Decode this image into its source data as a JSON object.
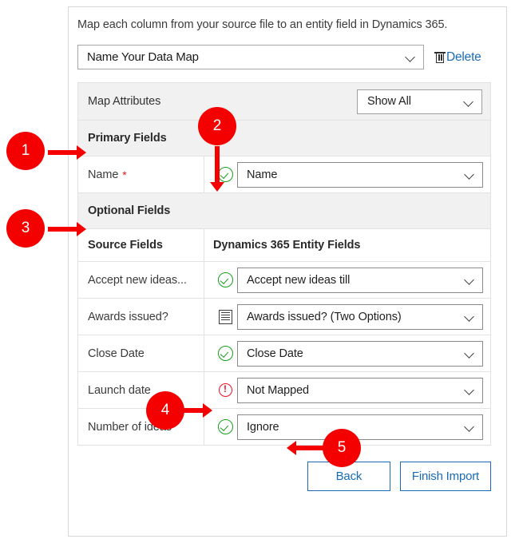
{
  "panel": {
    "intro_text": "Map each column from your source file to an entity field in Dynamics 365."
  },
  "data_map": {
    "selected": "Name Your Data Map",
    "delete_label": "Delete",
    "trash_icon": "trash-icon",
    "chevron_icon": "chevron-down-icon"
  },
  "map_attributes": {
    "title": "Map Attributes",
    "filter_selected": "Show All"
  },
  "sections": {
    "primary_fields": "Primary Fields",
    "optional_fields": "Optional Fields"
  },
  "columns": {
    "source": "Source Fields",
    "target": "Dynamics 365 Entity Fields"
  },
  "primary_rows": [
    {
      "source": "Name",
      "required": true,
      "required_mark": "*",
      "status": "ok",
      "status_icon": "check-circle-icon",
      "target": "Name"
    }
  ],
  "optional_rows": [
    {
      "source": "Accept new ideas...",
      "status": "ok",
      "status_icon": "check-circle-icon",
      "target": "Accept new ideas till"
    },
    {
      "source": "Awards issued?",
      "status": "list",
      "status_icon": "option-list-icon",
      "target": "Awards issued? (Two Options)"
    },
    {
      "source": "Close Date",
      "status": "ok",
      "status_icon": "check-circle-icon",
      "target": "Close Date"
    },
    {
      "source": "Launch date",
      "status": "warning",
      "status_icon": "warning-circle-icon",
      "target": "Not Mapped"
    },
    {
      "source": "Number of ideas",
      "status": "ok",
      "status_icon": "check-circle-icon",
      "target": "Ignore"
    }
  ],
  "footer": {
    "back_label": "Back",
    "finish_label": "Finish Import"
  },
  "annotations": {
    "badge_1": "1",
    "badge_2": "2",
    "badge_3": "3",
    "badge_4": "4",
    "badge_5": "5"
  },
  "colors": {
    "accent_blue": "#1a6bb5",
    "callout_red": "#f40000",
    "status_ok_green": "#17a01a",
    "status_warn_red": "#e81123",
    "required_star": "#e01b1b",
    "header_gray": "#f1f1f1"
  }
}
